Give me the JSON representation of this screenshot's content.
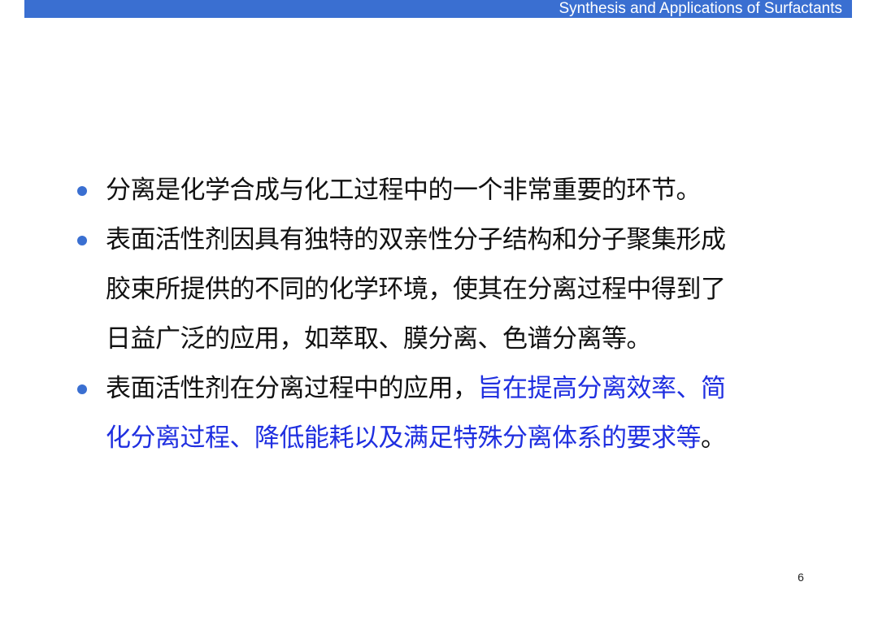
{
  "header": {
    "title": "Synthesis and Applications of Surfactants",
    "bar_color": "#3a6fd1"
  },
  "bullets": [
    {
      "lines": [
        "分离是化学合成与化工过程中的一个非常重要的环节。"
      ]
    },
    {
      "lines": [
        "表面活性剂因具有独特的双亲性分子结构和分子聚集形成",
        "胶束所提供的不同的化学环境，使其在分离过程中得到了",
        "日益广泛的应用，如萃取、膜分离、色谱分离等。"
      ]
    },
    {
      "line1_plain": "表面活性剂在分离过程中的应用，",
      "line1_highlight": "旨在提高分离效率、简",
      "line2_highlight": "化分离过程、降低能耗以及满足特殊分离体系的要求等",
      "line2_plain": "。",
      "highlight_color": "#1f2fe0"
    }
  ],
  "bullet_color": "#3a6fd1",
  "page_number": "6"
}
